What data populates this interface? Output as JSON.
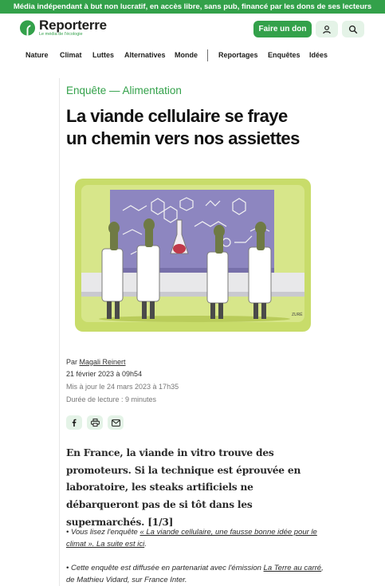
{
  "topbar": {
    "text": "Média indépendant à but non lucratif, en accès libre, sans pub, financé par les dons de ses lecteurs"
  },
  "brand": {
    "name": "Reporterre",
    "tagline": "Le média de l'écologie"
  },
  "header": {
    "donate_label": "Faire un don",
    "account_icon": "user-icon",
    "search_icon": "search-icon"
  },
  "nav": {
    "items": [
      {
        "label": "Nature"
      },
      {
        "label": "Climat"
      },
      {
        "label": "Luttes"
      },
      {
        "label": "Alternatives"
      },
      {
        "label": "Monde"
      },
      {
        "label": "Reportages"
      },
      {
        "label": "Enquêtes"
      },
      {
        "label": "Idées"
      }
    ]
  },
  "article": {
    "category": "Enquête — Alimentation",
    "title_line1": "La viande cellulaire se fraye",
    "title_line2": "un chemin vers nos assiettes",
    "illustration_signature": "ZURÉ",
    "byline_prefix": "Par",
    "author": "Magali Reinert",
    "published": "21 février 2023 à 09h54",
    "updated": "Mis à jour le 24 mars 2023 à 17h35",
    "reading_time": "Durée de lecture : 9 minutes",
    "share_icons": [
      "facebook-icon",
      "print-icon",
      "mail-icon"
    ],
    "chapo": "En France, la viande in vitro trouve des promoteurs. Si la technique est éprouvée en laboratoire, les steaks artificiels ne débarqueront pas de si tôt dans les supermarchés. [1/3]",
    "note1_prefix": "• Vous lisez l'enquête ",
    "note1_link": "« La viande cellulaire, une fausse bonne idée pour le climat ». La suite est ici",
    "note1_suffix": ".",
    "note2_prefix": "• Cette enquête est diffusée en partenariat avec l'émission ",
    "note2_link": "La Terre au carré",
    "note2_suffix": ", de Mathieu Vidard, sur France Inter."
  },
  "colors": {
    "brand_green": "#33a14a",
    "light_green": "#e4f3e7",
    "text": "#1d1d1b"
  }
}
